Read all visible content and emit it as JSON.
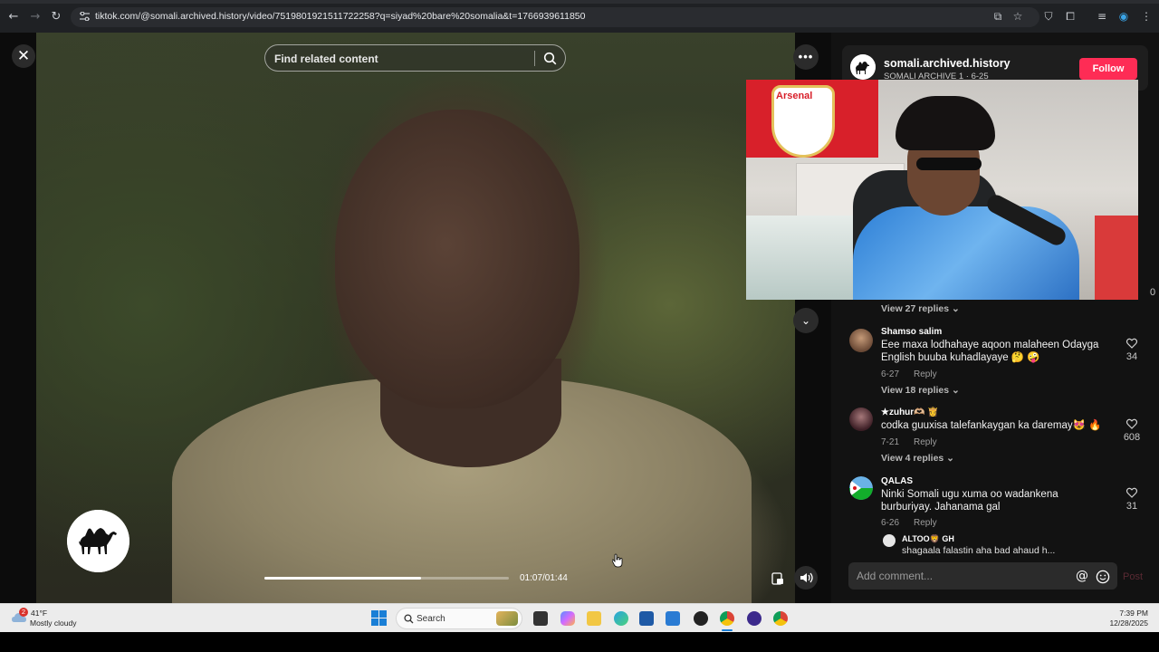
{
  "browser": {
    "url": "tiktok.com/@somali.archived.history/video/7519801921511722258?q=siyad%20bare%20somalia&t=1766939611850"
  },
  "player": {
    "search_placeholder": "Find related content",
    "time": "01:07/01:44",
    "progress_fraction": 0.64
  },
  "author": {
    "name": "somali.archived.history",
    "subtitle": "SOMALI ARCHIVE 1 · 6-25",
    "follow_label": "Follow"
  },
  "comments": {
    "partial_count": "0",
    "top_replies": "View 27 replies",
    "items": [
      {
        "user": "Shamso salim",
        "text": "Eee maxa lodhahaye aqoon malaheen Odayga English buuba kuhadlayaye 🤔 🤪",
        "date": "6-27",
        "reply": "Reply",
        "likes": "34",
        "replies": "View 18 replies"
      },
      {
        "user": "★zuhur🫶🏼 👸",
        "text": "codka guuxisa talefankaygan ka daremay😻 🔥",
        "date": "7-21",
        "reply": "Reply",
        "likes": "608",
        "replies": "View 4 replies"
      },
      {
        "user": "QALAS",
        "text": "Ninki Somali ugu xuma oo wadankena burburiyay. Jahanama gal",
        "date": "6-26",
        "reply": "Reply",
        "likes": "31",
        "replies": ""
      }
    ],
    "nested_user": "ALTOO🦁 GH",
    "nested_text": "shagaala falastin aha bad ahaud h...",
    "input_placeholder": "Add comment...",
    "post_label": "Post"
  },
  "webcam": {
    "flag_text": "Arsenal"
  },
  "taskbar": {
    "weather_badge": "2",
    "temperature": "41°F",
    "weather": "Mostly cloudy",
    "search_label": "Search",
    "time": "7:39 PM",
    "date": "12/28/2025"
  },
  "colors": {
    "follow": "#fe2c55",
    "panel_bg": "#121212",
    "taskbar_bg": "#ececec"
  }
}
